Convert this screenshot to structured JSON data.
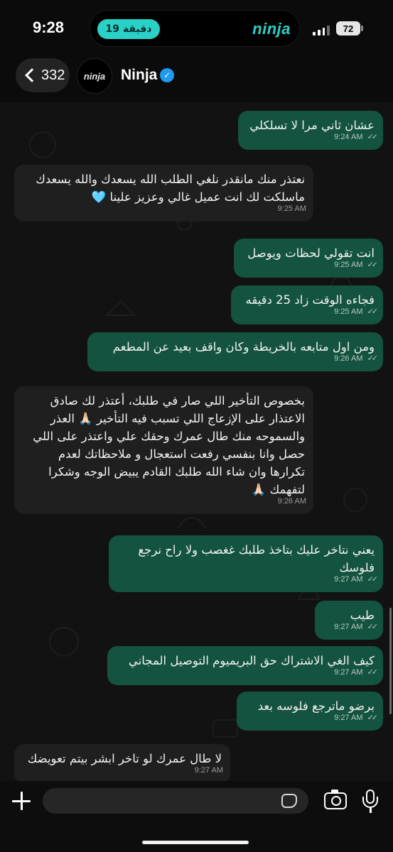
{
  "status_bar": {
    "time": "9:28",
    "activity_label": "19 دقيقة",
    "activity_brand": "ninja",
    "battery": "72"
  },
  "header": {
    "back_count": "332",
    "avatar_text": "ninja",
    "contact_name": "Ninja",
    "verified_icon": "verified-badge-icon"
  },
  "messages": [
    {
      "dir": "out",
      "text": "عشان ثاني مرا لا تسلكلي",
      "time": "9:24 AM"
    },
    {
      "dir": "in",
      "text": "نعتذر منك مانقدر نلغي الطلب الله يسعدك والله يسعدك ماسلكت لك انت عميل غالي وعزيز علينا 🩵",
      "time": "9:25 AM"
    },
    {
      "dir": "out",
      "text": "انت تقولي لحظات ويوصل",
      "time": "9:25 AM"
    },
    {
      "dir": "out",
      "text": "فجاءه الوقت زاد 25 دقيقه",
      "time": "9:25 AM"
    },
    {
      "dir": "out",
      "text": "ومن اول متابعه بالخريطة وكان واقف بعيد عن المطعم",
      "time": "9:26 AM"
    },
    {
      "dir": "in",
      "text": "بخصوص التأخير اللي صار في طلبك، أعتذر لك صادق الاعتذار على الإزعاج اللي تسبب فيه التأخير 🙏🏻 العذر والسموحه منك طال عمرك وحقك علي واعتذر على اللي حصل وانا بنفسي رفعت استعجال و ملاحظاتك لعدم تكرارها وان شاء الله طلبك القادم يبيض الوجه وشكرا لتفهمك 🙏🏻",
      "time": "9:26 AM"
    },
    {
      "dir": "out",
      "text": "يعني نتاخر عليك بتاخذ طلبك غغصب ولا راح نرجع فلوسك",
      "time": "9:27 AM"
    },
    {
      "dir": "out",
      "text": "طيب",
      "time": "9:27 AM"
    },
    {
      "dir": "out",
      "text": "كيف الغي الاشتراك حق البريميوم التوصيل المجاني",
      "time": "9:27 AM"
    },
    {
      "dir": "out",
      "text": "برضو ماترجع فلوسه بعد",
      "time": "9:27 AM"
    },
    {
      "dir": "in",
      "text": "لا طال عمرك لو تاخر ابشر بيتم تعويضك",
      "time": "9:27 AM"
    }
  ],
  "read_ticks": "✓✓",
  "composer": {
    "placeholder": "",
    "icons": [
      "plus-icon",
      "sticker-icon",
      "camera-icon",
      "microphone-icon"
    ]
  },
  "colors": {
    "outgoing_bubble": "#13533f",
    "incoming_bubble": "#1f1f1f",
    "accent": "#2ad1c7",
    "verified": "#1d9bf0"
  }
}
